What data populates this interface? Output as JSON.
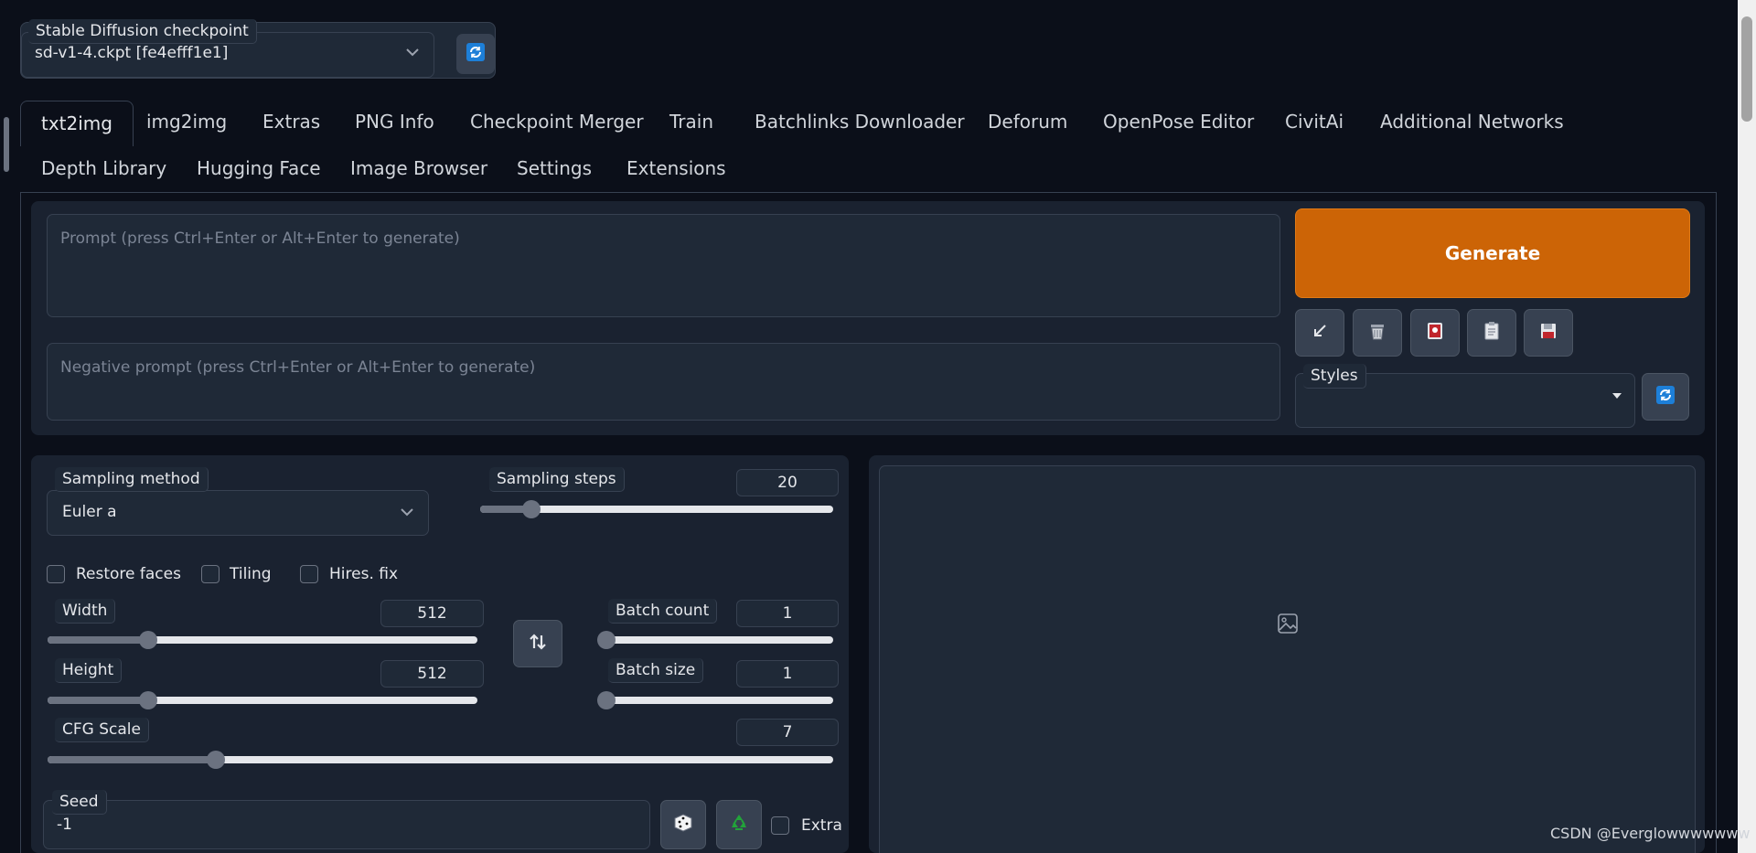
{
  "checkpoint": {
    "label": "Stable Diffusion checkpoint",
    "value": "sd-v1-4.ckpt [fe4efff1e1]",
    "refresh_icon": "refresh-icon"
  },
  "tabs_row1": [
    "txt2img",
    "img2img",
    "Extras",
    "PNG Info",
    "Checkpoint Merger",
    "Train",
    "Batchlinks Downloader",
    "Deforum",
    "OpenPose Editor",
    "CivitAi",
    "Additional Networks"
  ],
  "tabs_row2": [
    "Depth Library",
    "Hugging Face",
    "Image Browser",
    "Settings",
    "Extensions"
  ],
  "active_tab": "txt2img",
  "prompt": {
    "placeholder": "Prompt (press Ctrl+Enter or Alt+Enter to generate)",
    "value": ""
  },
  "negative_prompt": {
    "placeholder": "Negative prompt (press Ctrl+Enter or Alt+Enter to generate)",
    "value": ""
  },
  "generate": {
    "label": "Generate",
    "color": "#cc6406"
  },
  "tool_icons": [
    "arrow-diagonal-icon",
    "trash-icon",
    "red-card-icon",
    "clipboard-icon",
    "floppy-disk-icon"
  ],
  "styles": {
    "label": "Styles",
    "value": ""
  },
  "sampling_method": {
    "label": "Sampling method",
    "value": "Euler a"
  },
  "sampling_steps": {
    "label": "Sampling steps",
    "value": "20",
    "fraction": 0.146
  },
  "checkboxes": [
    {
      "label": "Restore faces",
      "checked": false
    },
    {
      "label": "Tiling",
      "checked": false
    },
    {
      "label": "Hires. fix",
      "checked": false
    }
  ],
  "width": {
    "label": "Width",
    "value": "512",
    "fraction": 0.235
  },
  "height": {
    "label": "Height",
    "value": "512",
    "fraction": 0.235
  },
  "batch_count": {
    "label": "Batch count",
    "value": "1",
    "fraction": 0.0
  },
  "batch_size": {
    "label": "Batch size",
    "value": "1",
    "fraction": 0.0
  },
  "cfg_scale": {
    "label": "CFG Scale",
    "value": "7",
    "fraction": 0.214
  },
  "seed": {
    "label": "Seed",
    "value": "-1",
    "extra_label": "Extra"
  },
  "watermark": "CSDN @Everglowwwwwww",
  "colors": {
    "accent": "#cc6406",
    "refresh_blue": "#1d7fd8",
    "recycle_green": "#22a33a"
  }
}
